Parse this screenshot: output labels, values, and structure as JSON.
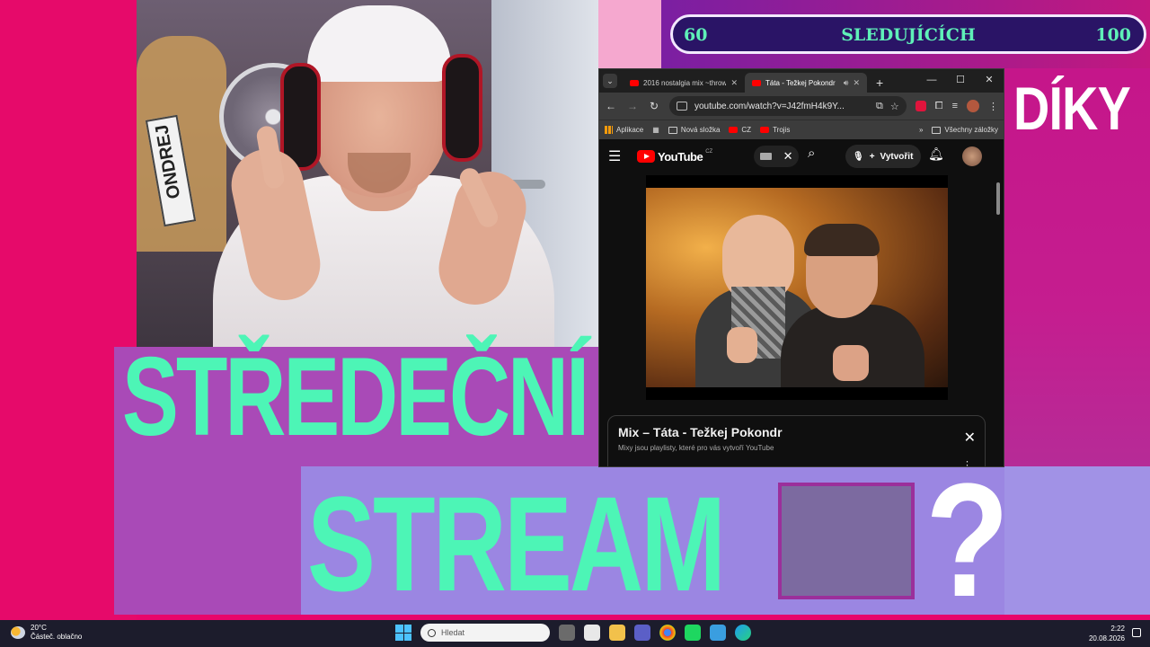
{
  "overlay": {
    "follow_goal": {
      "min": "60",
      "label": "SLEDUJÍCÍCH",
      "max": "100",
      "progress_fraction": 0.0
    },
    "thanks_text": "DÍKY",
    "title_line1": "STŘEDEČNÍ",
    "title_line2": "STREAM",
    "title_symbol": "?",
    "webcam_plate_text": "ONDREJ"
  },
  "browser": {
    "tabs": [
      {
        "title": "2016 nostalgia mix ~throw",
        "active": false
      },
      {
        "title": "Táta - Težkej Pokondr",
        "active": true
      }
    ],
    "new_tab_symbol": "+",
    "url": "youtube.com/watch?v=J42fmH4k9Y...",
    "bookmarks": [
      {
        "label": "Aplikace",
        "icon": "apps-grid-icon"
      },
      {
        "label": "Nová složka",
        "icon": "folder-icon"
      },
      {
        "label": "CZ",
        "icon": "youtube-icon"
      },
      {
        "label": "Trojis",
        "icon": "youtube-icon"
      }
    ],
    "all_bookmarks_label": "Všechny záložky"
  },
  "youtube": {
    "logo_text": "YouTube",
    "logo_region": "CZ",
    "create_label": "Vytvořit",
    "mix_panel": {
      "title": "Mix – Táta - Težkej Pokondr",
      "subtitle": "Mixy jsou playlisty, které pro vás vytvoří YouTube"
    }
  },
  "taskbar": {
    "weather_temp": "20°C",
    "weather_desc": "Částeč. oblačno",
    "search_placeholder": "Hledat",
    "time": "2:22",
    "date": "20.08.2026"
  },
  "colors": {
    "accent_green": "#4df5b6",
    "pink": "#e60a6a",
    "purple": "#a94ab7",
    "lavender": "#9b86e2",
    "youtube_red": "#ff0000"
  }
}
